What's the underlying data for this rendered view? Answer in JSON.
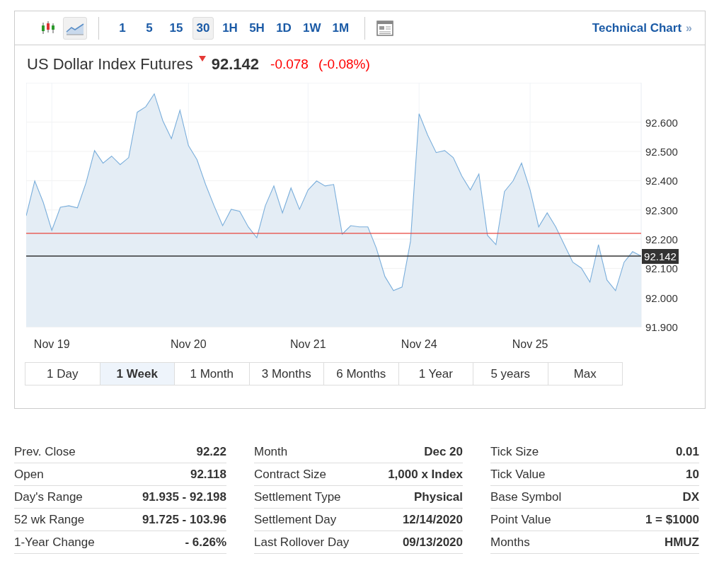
{
  "toolbar": {
    "chart_types": [
      {
        "kind": "candles",
        "selected": false
      },
      {
        "kind": "area",
        "selected": true
      }
    ],
    "intervals": [
      {
        "label": "1",
        "selected": false
      },
      {
        "label": "5",
        "selected": false
      },
      {
        "label": "15",
        "selected": false
      },
      {
        "label": "30",
        "selected": true
      },
      {
        "label": "1H",
        "selected": false
      },
      {
        "label": "5H",
        "selected": false
      },
      {
        "label": "1D",
        "selected": false
      },
      {
        "label": "1W",
        "selected": false
      },
      {
        "label": "1M",
        "selected": false
      }
    ],
    "link": {
      "label": "Technical Chart",
      "arrow": "»"
    }
  },
  "quote": {
    "name": "US Dollar Index Futures",
    "falling": true,
    "price": "92.142",
    "change": "-0.078",
    "change_pct": "(-0.08%)"
  },
  "chart_data": {
    "type": "area",
    "ylim": [
      91.9,
      92.735
    ],
    "categories": [
      null,
      null,
      null,
      "Nov 19",
      null,
      null,
      null,
      null,
      null,
      null,
      null,
      null,
      null,
      null,
      null,
      null,
      null,
      null,
      null,
      "Nov 20",
      null,
      null,
      null,
      null,
      null,
      null,
      null,
      null,
      null,
      null,
      null,
      null,
      null,
      "Nov 21",
      null,
      null,
      null,
      null,
      null,
      null,
      null,
      null,
      null,
      null,
      null,
      null,
      "Nov 24",
      null,
      null,
      null,
      null,
      null,
      null,
      null,
      null,
      null,
      null,
      null,
      null,
      "Nov 25",
      null,
      null,
      null,
      null,
      null,
      null,
      null,
      null,
      null,
      null,
      null,
      null,
      null
    ],
    "yticks": [
      {
        "value": 91.9,
        "label": "91.900"
      },
      {
        "value": 92.0,
        "label": "92.000"
      },
      {
        "value": 92.1,
        "label": "92.100"
      },
      {
        "value": 92.2,
        "label": "92.200"
      },
      {
        "value": 92.3,
        "label": "92.300"
      },
      {
        "value": 92.4,
        "label": "92.400"
      },
      {
        "value": 92.5,
        "label": "92.500"
      },
      {
        "value": 92.6,
        "label": "92.600"
      }
    ],
    "series": [
      {
        "color": "#7aaedb",
        "values": [
          92.28,
          92.399,
          92.326,
          92.23,
          92.309,
          92.314,
          92.307,
          92.392,
          92.503,
          92.46,
          92.484,
          92.455,
          92.479,
          92.634,
          92.653,
          92.697,
          92.605,
          92.544,
          92.641,
          92.52,
          92.472,
          92.387,
          92.314,
          92.246,
          92.302,
          92.295,
          92.242,
          92.205,
          92.314,
          92.382,
          92.29,
          92.375,
          92.302,
          92.368,
          92.399,
          92.382,
          92.387,
          92.217,
          92.246,
          92.242,
          92.242,
          92.169,
          92.072,
          92.024,
          92.036,
          92.193,
          92.629,
          92.556,
          92.496,
          92.503,
          92.479,
          92.416,
          92.368,
          92.423,
          92.213,
          92.181,
          92.363,
          92.399,
          92.46,
          92.368,
          92.242,
          92.29,
          92.242,
          92.181,
          92.121,
          92.101,
          92.053,
          92.181,
          92.06,
          92.024,
          92.121,
          92.157,
          92.142
        ]
      }
    ],
    "grid": true,
    "ref_lines": [
      {
        "axis": "y",
        "value": 92.22,
        "color": "#e8453c"
      },
      {
        "axis": "y",
        "value": 92.142,
        "color": "#333333",
        "label": "92.142"
      }
    ]
  },
  "ranges": [
    {
      "label": "1 Day",
      "selected": false
    },
    {
      "label": "1 Week",
      "selected": true
    },
    {
      "label": "1 Month",
      "selected": false
    },
    {
      "label": "3 Months",
      "selected": false
    },
    {
      "label": "6 Months",
      "selected": false
    },
    {
      "label": "1 Year",
      "selected": false
    },
    {
      "label": "5 years",
      "selected": false
    },
    {
      "label": "Max",
      "selected": false
    }
  ],
  "stats": [
    [
      {
        "label": "Prev. Close",
        "value": "92.22"
      },
      {
        "label": "Open",
        "value": "92.118"
      },
      {
        "label": "Day's Range",
        "value": "91.935 - 92.198"
      },
      {
        "label": "52 wk Range",
        "value": "91.725 - 103.96"
      },
      {
        "label": "1-Year Change",
        "value": "- 6.26%"
      }
    ],
    [
      {
        "label": "Month",
        "value": "Dec 20"
      },
      {
        "label": "Contract Size",
        "value": "1,000 x Index"
      },
      {
        "label": "Settlement Type",
        "value": "Physical"
      },
      {
        "label": "Settlement Day",
        "value": "12/14/2020"
      },
      {
        "label": "Last Rollover Day",
        "value": "09/13/2020"
      }
    ],
    [
      {
        "label": "Tick Size",
        "value": "0.01"
      },
      {
        "label": "Tick Value",
        "value": "10"
      },
      {
        "label": "Base Symbol",
        "value": "DX"
      },
      {
        "label": "Point Value",
        "value": "1 = $1000"
      },
      {
        "label": "Months",
        "value": "HMUZ"
      }
    ]
  ]
}
